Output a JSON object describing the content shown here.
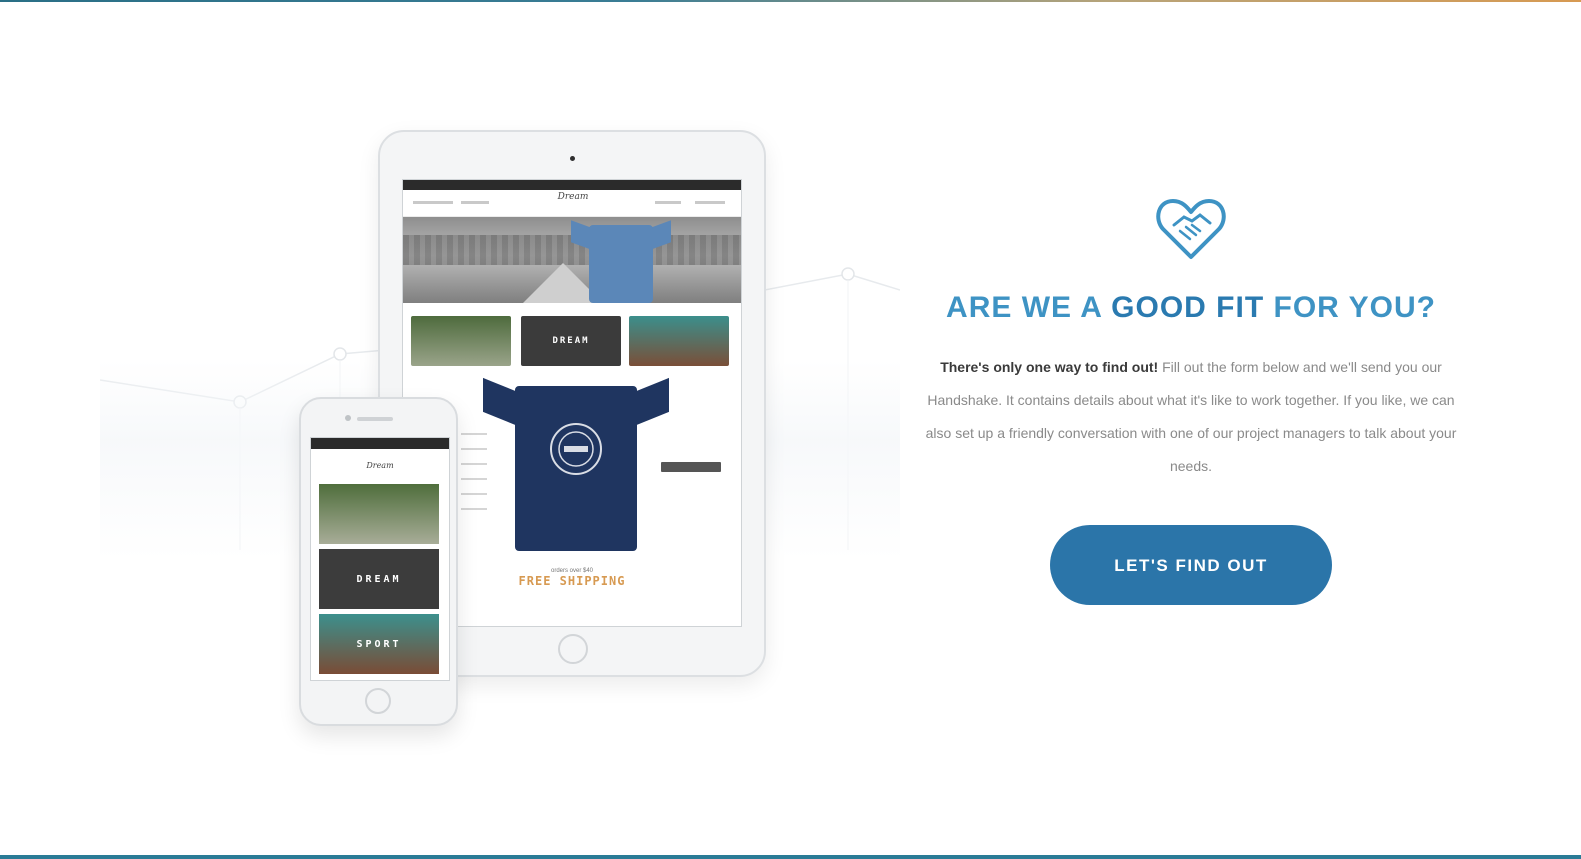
{
  "section": {
    "heading_part1": "ARE WE A ",
    "heading_strong": "GOOD FIT",
    "heading_part2": " FOR YOU?",
    "description_lead": "There's only one way to find out!",
    "description_rest": " Fill out the form below and we'll send you our Handshake. It contains details about what it's like to work together. If you like, we can also set up a friendly conversation with one of our project managers to talk about your needs.",
    "cta_label": "LET'S FIND OUT",
    "icon": "heart-handshake-icon"
  },
  "mockup": {
    "tablet_tiles": [
      "",
      "DREAM",
      ""
    ],
    "tablet_caption_small": "orders over $40",
    "tablet_caption_big": "FREE SHIPPING",
    "phone_tiles": [
      "",
      "DREAM",
      "SPORT"
    ]
  },
  "colors": {
    "accent": "#3e93c4",
    "button": "#2b75a9",
    "orange": "#d79a52"
  }
}
